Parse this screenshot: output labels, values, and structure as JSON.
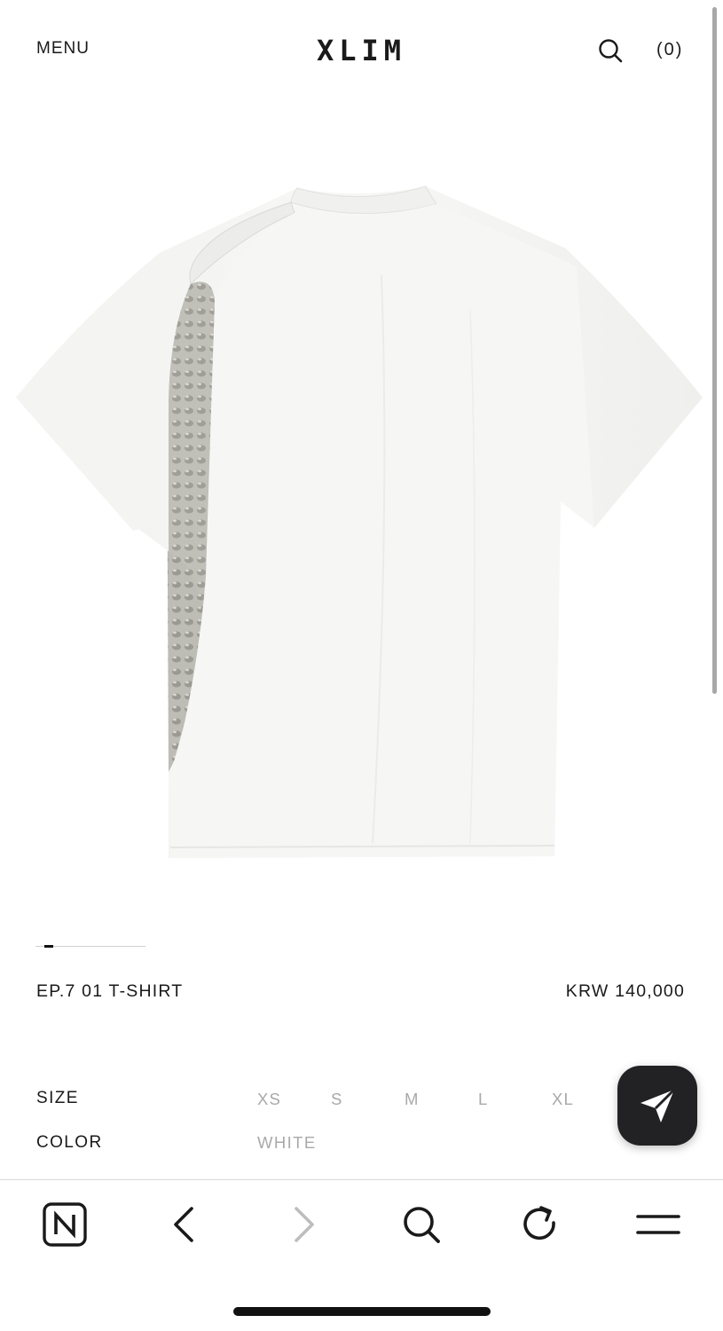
{
  "header": {
    "menu_label": "MENU",
    "logo": "XLIM",
    "search_icon": "search-icon",
    "cart_label": "(0)"
  },
  "product": {
    "image_alt": "EP.7 01 T-SHIRT back view",
    "carousel": {
      "current": 1
    },
    "name": "EP.7 01 T-SHIRT",
    "price": "KRW 140,000"
  },
  "options": {
    "size_label": "SIZE",
    "sizes": [
      "XS",
      "S",
      "M",
      "L",
      "XL"
    ],
    "color_label": "COLOR",
    "color_value": "WHITE"
  },
  "fab": {
    "icon": "send-icon"
  },
  "browser_toolbar": {
    "icons": [
      "naver-icon",
      "back-icon",
      "forward-icon",
      "search-icon",
      "reload-icon",
      "menu-icon"
    ]
  },
  "colors": {
    "text": "#1a1a1a",
    "muted": "#a9a9a9",
    "fab_bg": "#222225"
  }
}
